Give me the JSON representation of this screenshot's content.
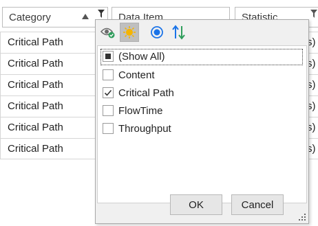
{
  "grid": {
    "columns": [
      {
        "label": "Category",
        "sort": "ascending",
        "filtered": true
      },
      {
        "label": "Data Item"
      },
      {
        "label": "Statistic",
        "filtered": true
      }
    ],
    "rows": [
      {
        "category": "Critical Path",
        "tail": "s)"
      },
      {
        "category": "Critical Path",
        "tail": "s)"
      },
      {
        "category": "Critical Path",
        "tail": "s)"
      },
      {
        "category": "Critical Path",
        "tail": "s)"
      },
      {
        "category": "Critical Path",
        "tail": "s)"
      },
      {
        "category": "Critical Path",
        "tail": "s)"
      }
    ]
  },
  "filter_popup": {
    "toolbar": [
      {
        "icon": "eye-check-icon"
      },
      {
        "icon": "sun-icon",
        "active": true
      },
      {
        "icon": "radio-icon"
      },
      {
        "icon": "sort-arrows-icon"
      }
    ],
    "items": [
      {
        "label": "(Show All)",
        "state": "indeterminate",
        "focused": true
      },
      {
        "label": "Content",
        "state": "unchecked"
      },
      {
        "label": "Critical Path",
        "state": "checked"
      },
      {
        "label": "FlowTime",
        "state": "unchecked"
      },
      {
        "label": "Throughput",
        "state": "unchecked"
      }
    ],
    "ok_label": "OK",
    "cancel_label": "Cancel"
  },
  "colors": {
    "accent_blue": "#1a73e8",
    "sort_green": "#2e9d5b",
    "sun_yellow": "#f5b400"
  }
}
